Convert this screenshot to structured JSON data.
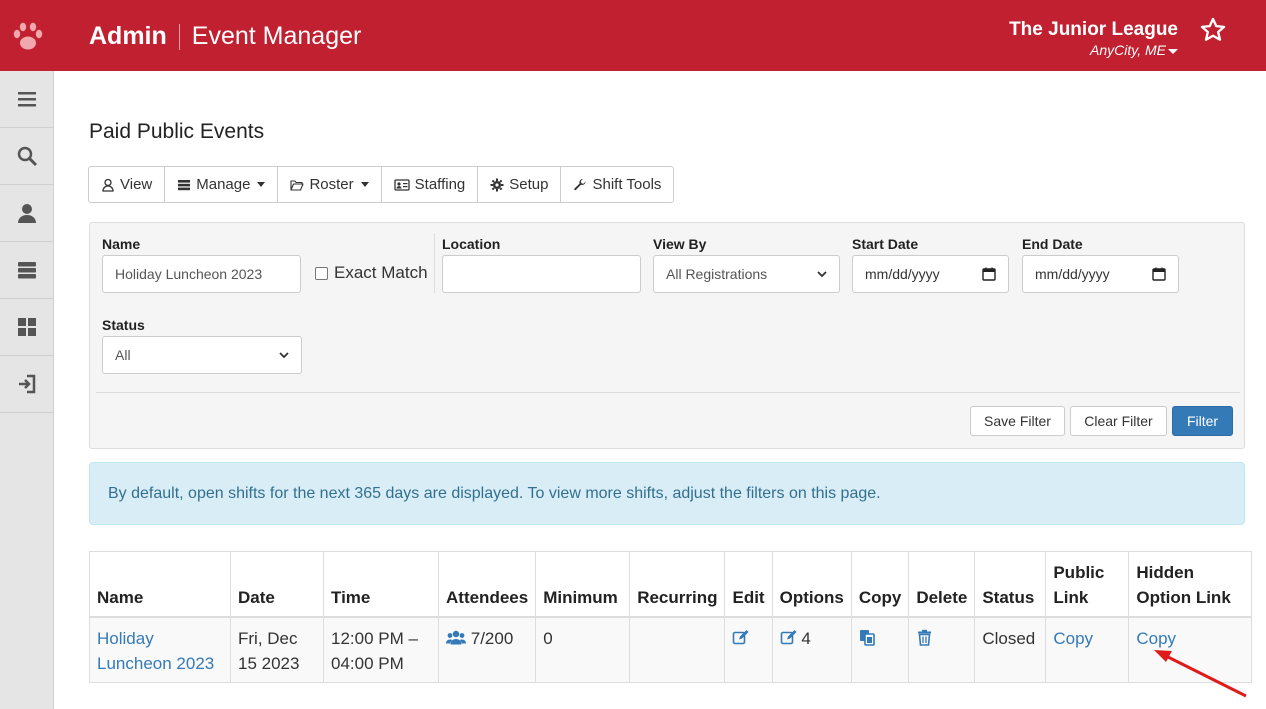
{
  "header": {
    "admin_label": "Admin",
    "app_title": "Event Manager",
    "org_name": "The Junior League",
    "org_city": "AnyCity, ME",
    "brand_color": "#c0202f"
  },
  "sidebar": {
    "items": [
      {
        "icon": "menu-icon"
      },
      {
        "icon": "search-icon"
      },
      {
        "icon": "user-icon"
      },
      {
        "icon": "server-icon"
      },
      {
        "icon": "dashboard-icon"
      },
      {
        "icon": "sign-in-icon"
      }
    ]
  },
  "page": {
    "title": "Paid Public Events"
  },
  "toolbar": {
    "view": "View",
    "manage": "Manage",
    "roster": "Roster",
    "staffing": "Staffing",
    "setup": "Setup",
    "shift_tools": "Shift Tools"
  },
  "filters": {
    "name_label": "Name",
    "name_value": "Holiday Luncheon 2023",
    "exact_match_label": "Exact Match",
    "exact_match_checked": false,
    "location_label": "Location",
    "location_value": "",
    "view_by_label": "View By",
    "view_by_value": "All Registrations",
    "start_date_label": "Start Date",
    "start_date_placeholder": "mm/dd/yyyy",
    "end_date_label": "End Date",
    "end_date_placeholder": "mm/dd/yyyy",
    "status_label": "Status",
    "status_value": "All",
    "save_filter": "Save Filter",
    "clear_filter": "Clear Filter",
    "filter": "Filter"
  },
  "alert": {
    "text": "By default, open shifts for the next 365 days are displayed. To view more shifts, adjust the filters on this page."
  },
  "table": {
    "headers": {
      "name": "Name",
      "date": "Date",
      "time": "Time",
      "attendees": "Attendees",
      "minimum": "Minimum",
      "recurring": "Recurring",
      "edit": "Edit",
      "options": "Options",
      "copy": "Copy",
      "delete": "Delete",
      "status": "Status",
      "public_link_1": "Public",
      "public_link_2": "Link",
      "hidden_link_1": "Hidden",
      "hidden_link_2": "Option Link"
    },
    "rows": [
      {
        "name": "Holiday Luncheon 2023",
        "date": "Fri, Dec 15 2023",
        "time": "12:00 PM – 04:00 PM",
        "attendees": "7/200",
        "minimum": "0",
        "recurring": "",
        "options_count": "4",
        "status": "Closed",
        "public_link": "Copy",
        "hidden_option_link": "Copy"
      }
    ]
  }
}
